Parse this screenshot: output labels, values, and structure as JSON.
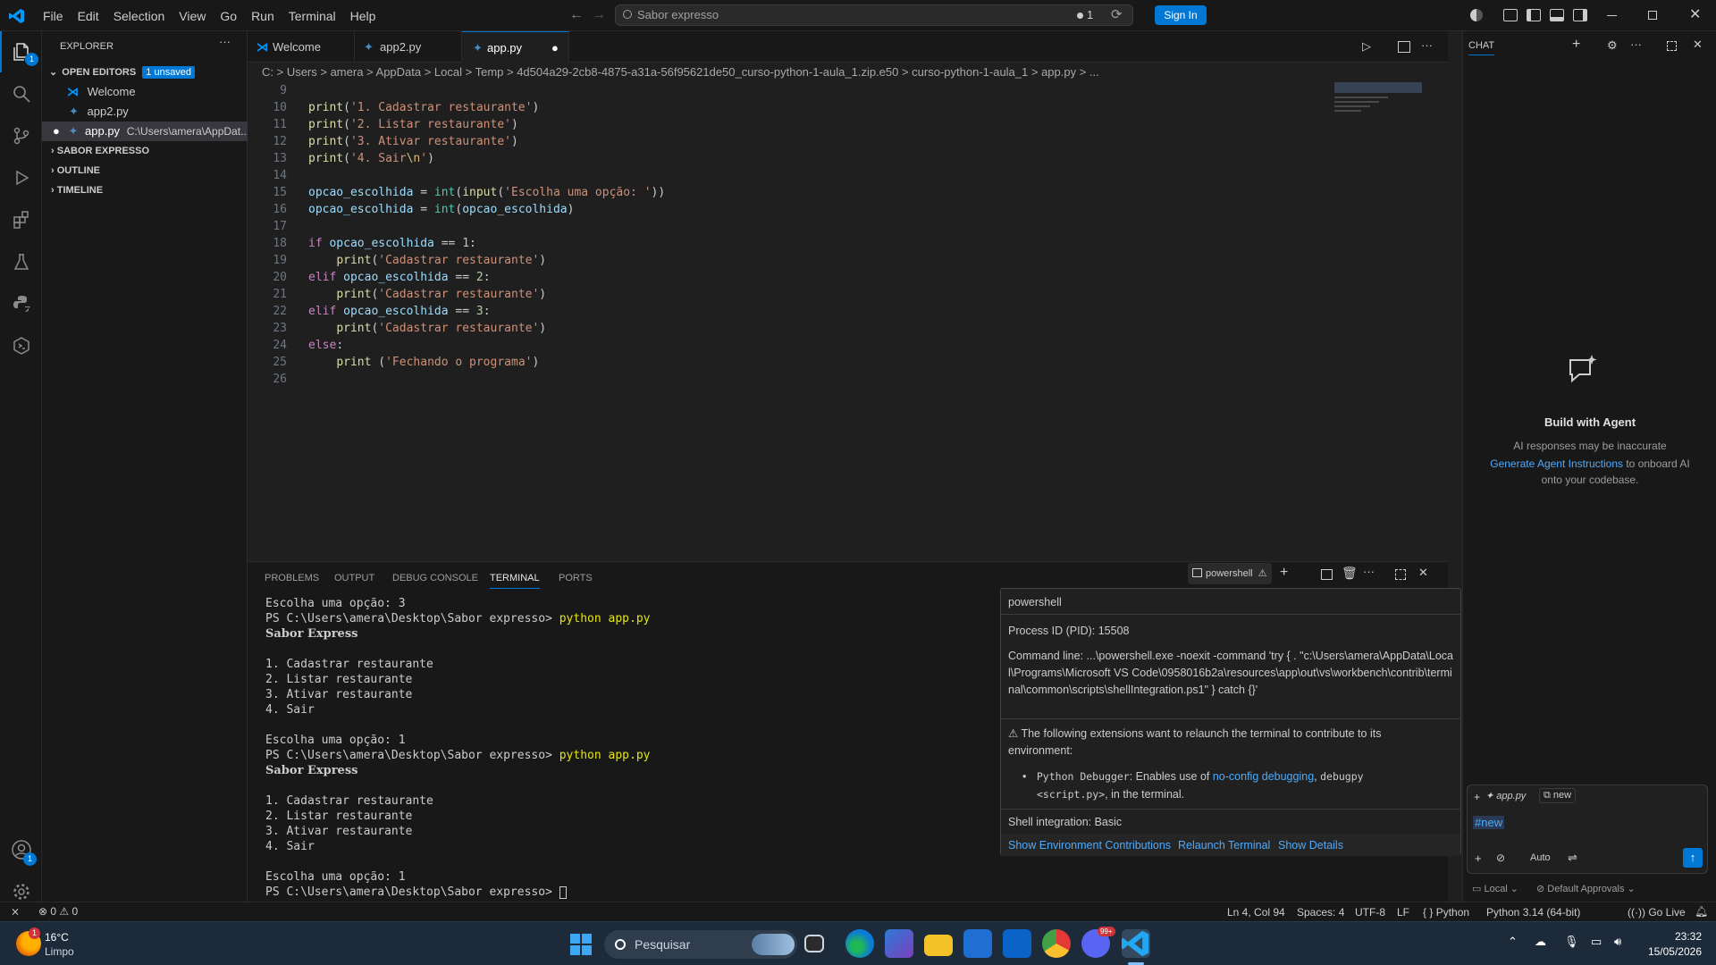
{
  "menu": [
    "File",
    "Edit",
    "Selection",
    "View",
    "Go",
    "Run",
    "Terminal",
    "Help"
  ],
  "command_center": "Sabor expresso",
  "notif_count": "1",
  "sign_in": "Sign In",
  "explorer": {
    "title": "EXPLORER",
    "open_editors": "OPEN EDITORS",
    "unsaved_badge": "1 unsaved",
    "files": [
      {
        "name": "Welcome"
      },
      {
        "name": "app2.py"
      },
      {
        "name": "app.py",
        "path": "C:\\Users\\amera\\AppDat..."
      }
    ],
    "sections": [
      "SABOR EXPRESSO",
      "OUTLINE",
      "TIMELINE"
    ]
  },
  "tabs": [
    {
      "label": "Welcome"
    },
    {
      "label": "app2.py"
    },
    {
      "label": "app.py"
    }
  ],
  "breadcrumb": "C: > Users > amera > AppData > Local > Temp > 4d504a29-2cb8-4875-a31a-56f95621de50_curso-python-1-aula_1.zip.e50 > curso-python-1-aula_1 > app.py > ...",
  "code_lines": [
    {
      "n": "9",
      "html": ""
    },
    {
      "n": "10",
      "html": "<span class='fn'>print</span>(<span class='str'>'1. Cadastrar restaurante'</span>)"
    },
    {
      "n": "11",
      "html": "<span class='fn'>print</span>(<span class='str'>'2. Listar restaurante'</span>)"
    },
    {
      "n": "12",
      "html": "<span class='fn'>print</span>(<span class='str'>'3. Ativar restaurante'</span>)"
    },
    {
      "n": "13",
      "html": "<span class='fn'>print</span>(<span class='str'>'4. Sair<span class=\"esc\">\\n</span>'</span>)"
    },
    {
      "n": "14",
      "html": ""
    },
    {
      "n": "15",
      "html": "<span class='var'>opcao_escolhida</span> = <span class='bi'>int</span>(<span class='fn'>input</span>(<span class='str'>'Escolha uma opção: '</span>))"
    },
    {
      "n": "16",
      "html": "<span class='var'>opcao_escolhida</span> = <span class='bi'>int</span>(<span class='var'>opcao_escolhida</span>)"
    },
    {
      "n": "17",
      "html": ""
    },
    {
      "n": "18",
      "html": "<span class='kw'>if</span> <span class='var'>opcao_escolhida</span> == <span class='num'>1</span>:"
    },
    {
      "n": "19",
      "html": "    <span class='fn'>print</span>(<span class='str'>'Cadastrar restaurante'</span>)"
    },
    {
      "n": "20",
      "html": "<span class='kw'>elif</span> <span class='var'>opcao_escolhida</span> == <span class='num'>2</span>:"
    },
    {
      "n": "21",
      "html": "    <span class='fn'>print</span>(<span class='str'>'Cadastrar restaurante'</span>)"
    },
    {
      "n": "22",
      "html": "<span class='kw'>elif</span> <span class='var'>opcao_escolhida</span> == <span class='num'>3</span>:"
    },
    {
      "n": "23",
      "html": "    <span class='fn'>print</span>(<span class='str'>'Cadastrar restaurante'</span>)"
    },
    {
      "n": "24",
      "html": "<span class='kw'>else</span>:"
    },
    {
      "n": "25",
      "html": "    <span class='fn'>print</span> (<span class='str'>'Fechando o programa'</span>)"
    },
    {
      "n": "26",
      "html": ""
    }
  ],
  "panel_tabs": [
    "PROBLEMS",
    "OUTPUT",
    "DEBUG CONSOLE",
    "TERMINAL",
    "PORTS"
  ],
  "terminal_name": "powershell",
  "terminal_lines": [
    "Escolha uma opção: 3",
    "PS C:\\Users\\amera\\Desktop\\Sabor expresso> |python app.py",
    "Sabor Express",
    "",
    "1. Cadastrar restaurante",
    "2. Listar restaurante",
    "3. Ativar restaurante",
    "4. Sair",
    "",
    "Escolha uma opção: 1",
    "PS C:\\Users\\amera\\Desktop\\Sabor expresso> |python app.py",
    "Sabor Express",
    "",
    "1. Cadastrar restaurante",
    "2. Listar restaurante",
    "3. Ativar restaurante",
    "4. Sair",
    "",
    "Escolha uma opção: 1",
    "PS C:\\Users\\amera\\Desktop\\Sabor expresso> "
  ],
  "hover": {
    "title": "powershell",
    "pid": "Process ID (PID): 15508",
    "cmd": "Command line: ...\\powershell.exe -noexit -command 'try { . \"c:\\Users\\amera\\AppData\\Local\\Programs\\Microsoft VS Code\\0958016b2a\\resources\\app\\out\\vs\\workbench\\contrib\\terminal\\common\\scripts\\shellIntegration.ps1\" } catch {}'",
    "warning": "⚠ The following extensions want to relaunch the terminal to contribute to its environment:",
    "ext_name": "Python Debugger",
    "ext_desc1": ": Enables use of ",
    "ext_link": "no-config debugging",
    "ext_desc2": ", ",
    "ext_code1": "debugpy",
    "ext_code2": "<script.py>",
    "ext_desc3": ", in the terminal.",
    "shell_integration": "Shell integration: Basic",
    "actions": [
      "Show Environment Contributions",
      "Relaunch Terminal",
      "Show Details"
    ]
  },
  "chat": {
    "title": "CHAT",
    "heading": "Build with Agent",
    "line1": "AI responses may be inaccurate",
    "link": "Generate Agent Instructions",
    "line2": " to onboard AI",
    "line3": "onto your codebase.",
    "ctx_file": "app.py",
    "ctx_new": "new",
    "input": "#new",
    "mode": "Auto",
    "local": "Local",
    "approvals": "Default Approvals"
  },
  "status": {
    "errors": "0",
    "warnings": "0",
    "position": "Ln 4, Col 94",
    "spaces": "Spaces: 4",
    "encoding": "UTF-8",
    "eol": "LF",
    "lang": "Python",
    "interpreter": "Python 3.14 (64-bit)",
    "golive": "Go Live"
  },
  "taskbar": {
    "temp": "16°C",
    "weather": "Limpo",
    "weather_badge": "1",
    "search": "Pesquisar",
    "time": "23:32",
    "date": "15/05/2026",
    "discord_badge": "99+"
  }
}
